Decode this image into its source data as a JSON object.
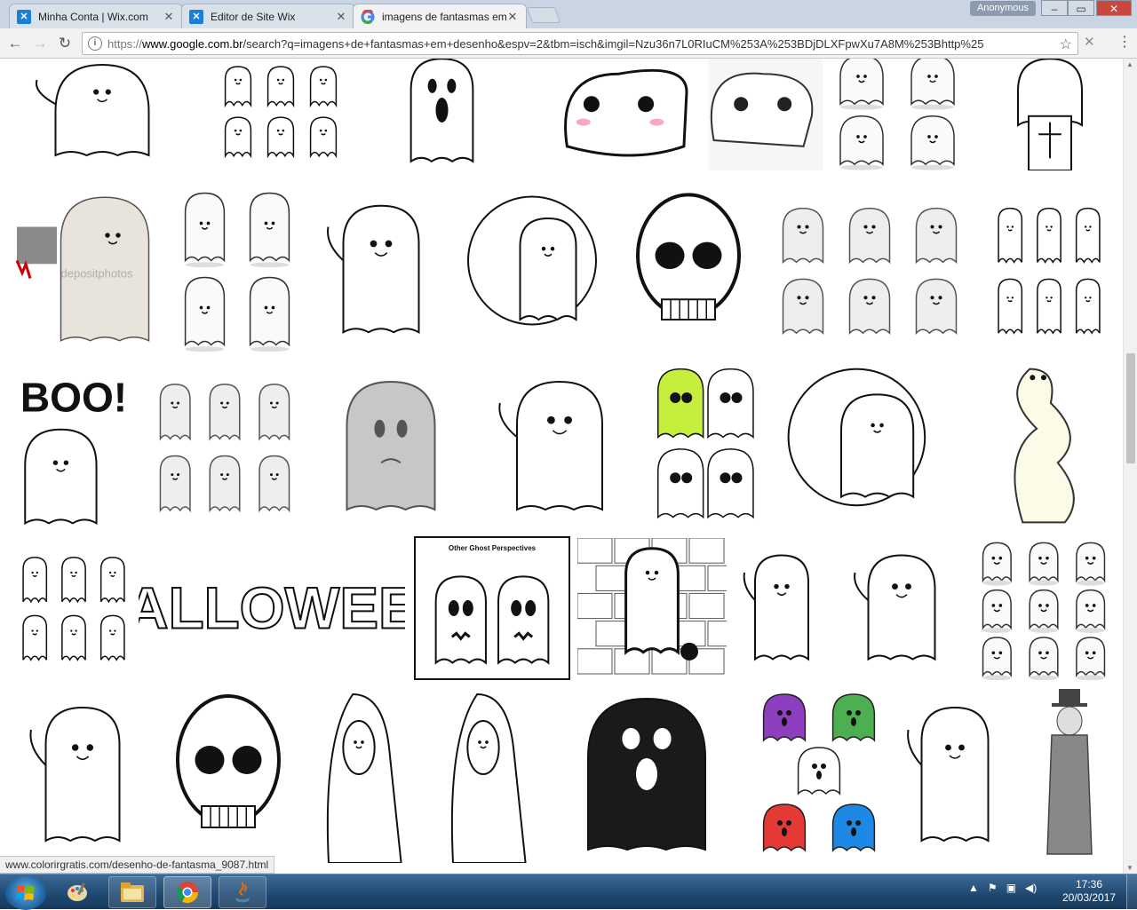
{
  "browser": {
    "tabs": [
      {
        "title": "Minha Conta | Wix.com",
        "favicon": "wix-icon",
        "active": false
      },
      {
        "title": "Editor de Site Wix",
        "favicon": "wix-icon",
        "active": false
      },
      {
        "title": "imagens de fantasmas em",
        "favicon": "google-icon",
        "active": true
      }
    ],
    "profile_label": "Anonymous",
    "window_controls": {
      "minimize": "–",
      "maximize": "▭",
      "close": "✕"
    },
    "url": {
      "scheme": "https://",
      "host": "www.google.com.br",
      "path": "/search?q=imagens+de+fantasmas+em+desenho&espv=2&tbm=isch&imgil=Nzu36n7L0RIuCM%253A%253BDjDLXFpwXu7A8M%253Bhttp%25"
    }
  },
  "results": [
    {
      "alt": "ghost cartoon"
    },
    {
      "alt": "baby ghosts with pumpkin"
    },
    {
      "alt": "screaming ghost"
    },
    {
      "alt": "kawaii ghost drawing"
    },
    {
      "alt": "ghost emoticons grid"
    },
    {
      "alt": "ghost with tombstone"
    },
    {
      "alt": "ghost with axe",
      "watermark": "depositphotos"
    },
    {
      "alt": "four cute ghosts"
    },
    {
      "alt": "ghost with bowtie and candy bag"
    },
    {
      "alt": "ghost over moon"
    },
    {
      "alt": "skull monster"
    },
    {
      "alt": "sketched ghosts"
    },
    {
      "alt": "haunted house ghosts"
    },
    {
      "alt": "BOO ghost",
      "text": "BOO!"
    },
    {
      "alt": "flying ghosts"
    },
    {
      "alt": "grey ghost"
    },
    {
      "alt": "ghost thinking of candy"
    },
    {
      "alt": "green and black ghosts"
    },
    {
      "alt": "ghost with lantern and moon"
    },
    {
      "alt": "long yellow ghost"
    },
    {
      "alt": "ghosts on pumpkins"
    },
    {
      "alt": "Halloween lettering",
      "text": "HALLOWEEN"
    },
    {
      "alt": "Other Ghost Perspectives",
      "text": "Other Ghost Perspectives"
    },
    {
      "alt": "chained ghost by brick wall"
    },
    {
      "alt": "small white ghost"
    },
    {
      "alt": "ghost with ball and chain"
    },
    {
      "alt": "ghost faces grid"
    },
    {
      "alt": "waving ghost with bowtie"
    },
    {
      "alt": "skull mask"
    },
    {
      "alt": "hooded grim ghost"
    },
    {
      "alt": "hooded ghost"
    },
    {
      "alt": "black ghost"
    },
    {
      "alt": "colorful ghosts"
    },
    {
      "alt": "floating ghost"
    },
    {
      "alt": "zombie in suit"
    }
  ],
  "status_url": "www.colorirgratis.com/desenho-de-fantasma_9087.html",
  "taskbar": {
    "clock_time": "17:36",
    "clock_date": "20/03/2017"
  },
  "colors": {
    "tab_active": "#f2f2f2",
    "taskbar": "#1f4870",
    "close_button": "#c9473c"
  }
}
